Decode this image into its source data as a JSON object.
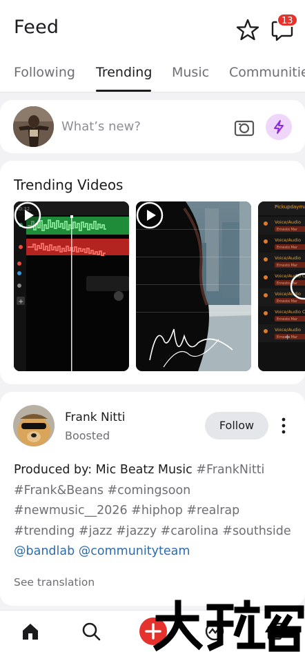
{
  "header": {
    "title": "Feed",
    "notification_count": "13",
    "icons": [
      "star-icon",
      "chat-icon"
    ]
  },
  "tabs": [
    {
      "label": "Following",
      "active": false
    },
    {
      "label": "Trending",
      "active": true
    },
    {
      "label": "Music",
      "active": false
    },
    {
      "label": "Communitie",
      "active": false
    }
  ],
  "composer": {
    "placeholder": "What’s new?",
    "icons": [
      "camera-icon",
      "lightning-icon"
    ]
  },
  "trending_videos": {
    "title": "Trending Videos",
    "videos": [
      {
        "thumbnail": "daw-multitrack-waveforms",
        "timecode": "00:32.",
        "track_label": "Add Track"
      },
      {
        "thumbnail": "man-silhouette-city-signature"
      },
      {
        "thumbnail": "voice-audio-tracks-list",
        "header_label": "Pickupdaymax",
        "track_labels": [
          "Voice/Audio",
          "Voice/Audio",
          "Voice/Audio",
          "Voice/Audio Co",
          "Voice/Audio",
          "Voice/Audio Co",
          "Voice/Audio"
        ],
        "sub_label": "Ernesto Mar"
      }
    ]
  },
  "post": {
    "author": "Frank Nitti",
    "status": "Boosted",
    "follow_label": "Follow",
    "text_lines": [
      [
        {
          "t": "Produced by: Mic Beatz Music ",
          "k": "text"
        },
        {
          "t": "#FrankNitti",
          "k": "tag"
        }
      ],
      [
        {
          "t": "#Frank&Beans #comingsoon",
          "k": "tag"
        }
      ],
      [
        {
          "t": "#newmusic__2026 #hiphop #realrap",
          "k": "tag"
        }
      ],
      [
        {
          "t": "#trending #jazz #jazzy #carolina #southside",
          "k": "tag"
        }
      ],
      [
        {
          "t": "@bandlab @communityteam",
          "k": "mention"
        }
      ]
    ],
    "see_translation": "See translation"
  },
  "bottom_nav": [
    "home-icon",
    "search-icon",
    "create-plus-icon",
    "chart-icon",
    "library-icon"
  ],
  "watermark": "大玩家",
  "colors": {
    "accent_red": "#e5322d",
    "boost_bg": "#efd6fb",
    "boost_icon": "#8a2be2",
    "mention": "#2c6cae",
    "hashtag": "#6e6e73"
  }
}
